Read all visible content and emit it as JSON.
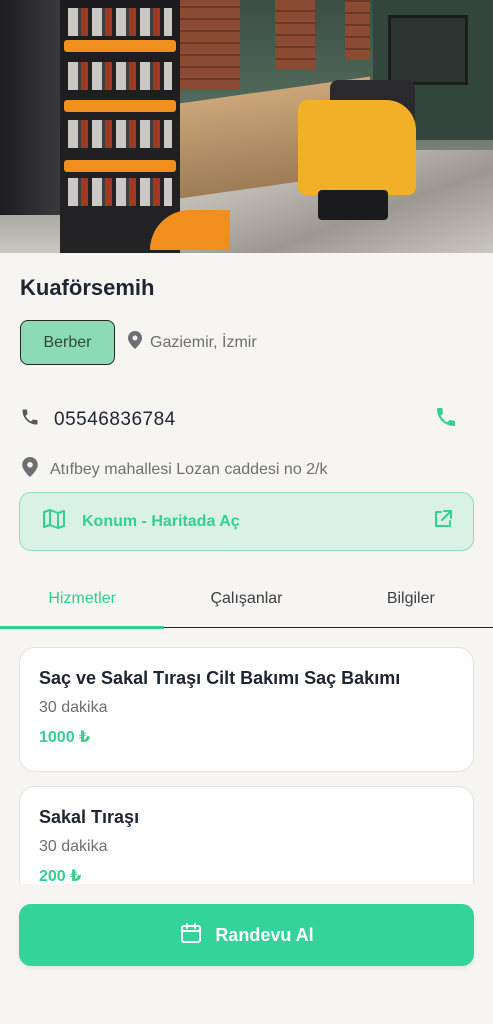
{
  "shop": {
    "name": "Kuaförsemih",
    "category": "Berber",
    "location": "Gaziemir, İzmir",
    "phone": "05546836784",
    "address": "Atıfbey mahallesi Lozan caddesi no 2/k"
  },
  "map_button": {
    "label": "Konum - Haritada Aç"
  },
  "tabs": [
    {
      "label": "Hizmetler",
      "active": true
    },
    {
      "label": "Çalışanlar",
      "active": false
    },
    {
      "label": "Bilgiler",
      "active": false
    }
  ],
  "services": [
    {
      "title": "Saç ve Sakal Tıraşı Cilt Bakımı Saç Bakımı",
      "duration": "30 dakika",
      "price": "1000 ₺"
    },
    {
      "title": "Sakal Tıraşı",
      "duration": "30 dakika",
      "price": "200 ₺"
    }
  ],
  "cta": {
    "label": "Randevu Al"
  },
  "colors": {
    "accent": "#34d399",
    "chip_bg": "#8ddbb4",
    "map_bg": "#daf2e6"
  },
  "icons": {
    "location": "map-pin-icon",
    "phone": "phone-icon",
    "call": "phone-call-icon",
    "map": "map-icon",
    "external": "external-link-icon",
    "calendar": "calendar-icon"
  }
}
